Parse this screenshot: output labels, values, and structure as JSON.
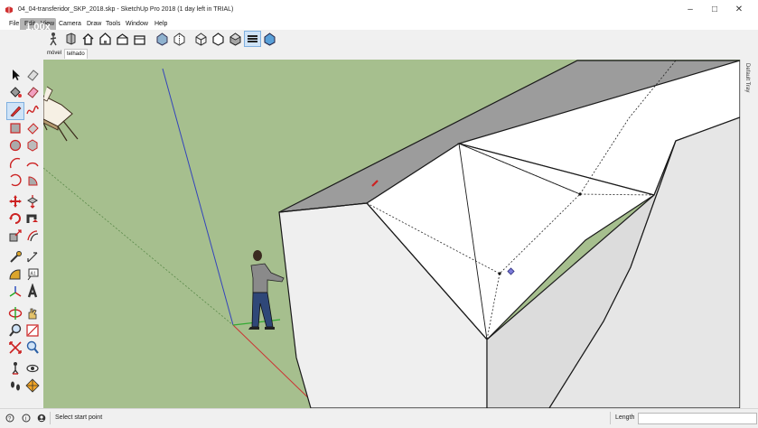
{
  "window": {
    "title": "04_04-transferidor_SKP_2018.skp - SketchUp Pro 2018 (1 day left in TRIAL)",
    "minimize": "–",
    "maximize": "□",
    "close": "✕"
  },
  "overlay": {
    "badge": "1.00x"
  },
  "menu": [
    {
      "label": "File"
    },
    {
      "label": "Edit"
    },
    {
      "label": "View"
    },
    {
      "label": "Camera"
    },
    {
      "label": "Draw"
    },
    {
      "label": "Tools"
    },
    {
      "label": "Window"
    },
    {
      "label": "Help"
    }
  ],
  "toolbar": [
    {
      "icon": "walk-icon"
    },
    {
      "icon": "component-icon"
    },
    {
      "icon": "house-icon"
    },
    {
      "icon": "front-view-icon"
    },
    {
      "icon": "right-view-icon"
    },
    {
      "icon": "back-view-icon"
    },
    {
      "icon": "xray-style-icon"
    },
    {
      "icon": "back-edges-style-icon"
    },
    {
      "icon": "wireframe-style-icon"
    },
    {
      "icon": "hidden-line-style-icon"
    },
    {
      "icon": "shaded-style-icon"
    },
    {
      "icon": "shaded-textures-style-icon"
    },
    {
      "icon": "monochrome-style-icon"
    }
  ],
  "scene_tabs": [
    {
      "label": "móvel"
    },
    {
      "label": "telhado"
    }
  ],
  "left_tools": [
    {
      "icon": "select-arrow-icon"
    },
    {
      "icon": "eraser-icon"
    },
    {
      "icon": "paint-bucket-icon"
    },
    {
      "icon": "tag-eraser-icon"
    },
    {
      "icon": "pencil-line-icon"
    },
    {
      "icon": "freehand-icon"
    },
    {
      "icon": "rectangle-icon"
    },
    {
      "icon": "rotated-rectangle-icon"
    },
    {
      "icon": "circle-icon"
    },
    {
      "icon": "polygon-icon"
    },
    {
      "icon": "arc-icon"
    },
    {
      "icon": "two-point-arc-icon"
    },
    {
      "icon": "three-point-arc-icon"
    },
    {
      "icon": "pie-icon"
    },
    {
      "icon": "move-icon"
    },
    {
      "icon": "push-pull-icon"
    },
    {
      "icon": "rotate-icon"
    },
    {
      "icon": "follow-me-icon"
    },
    {
      "icon": "scale-icon"
    },
    {
      "icon": "offset-icon"
    },
    {
      "icon": "tape-measure-icon"
    },
    {
      "icon": "dimension-icon"
    },
    {
      "icon": "protractor-icon"
    },
    {
      "icon": "text-icon"
    },
    {
      "icon": "axes-icon"
    },
    {
      "icon": "3d-text-icon"
    },
    {
      "icon": "orbit-icon"
    },
    {
      "icon": "pan-icon"
    },
    {
      "icon": "zoom-icon"
    },
    {
      "icon": "zoom-window-icon"
    },
    {
      "icon": "zoom-extents-icon"
    },
    {
      "icon": "previous-view-icon"
    },
    {
      "icon": "position-camera-icon"
    },
    {
      "icon": "look-around-icon"
    },
    {
      "icon": "walk-footprints-icon"
    },
    {
      "icon": "section-plane-icon"
    }
  ],
  "tray": {
    "label": "Default Tray"
  },
  "status": {
    "hint": "Select start point",
    "length_label": "Length",
    "length_value": ""
  },
  "colors": {
    "ground": "#a6bf8e",
    "roof_shadow": "#9c9c9c",
    "wall_light": "#efefef",
    "wall_mid": "#dcdcdc",
    "roof_top": "#ffffff",
    "axis_red": "#cc3333",
    "axis_green": "#33aa33",
    "axis_blue": "#3344bb"
  }
}
